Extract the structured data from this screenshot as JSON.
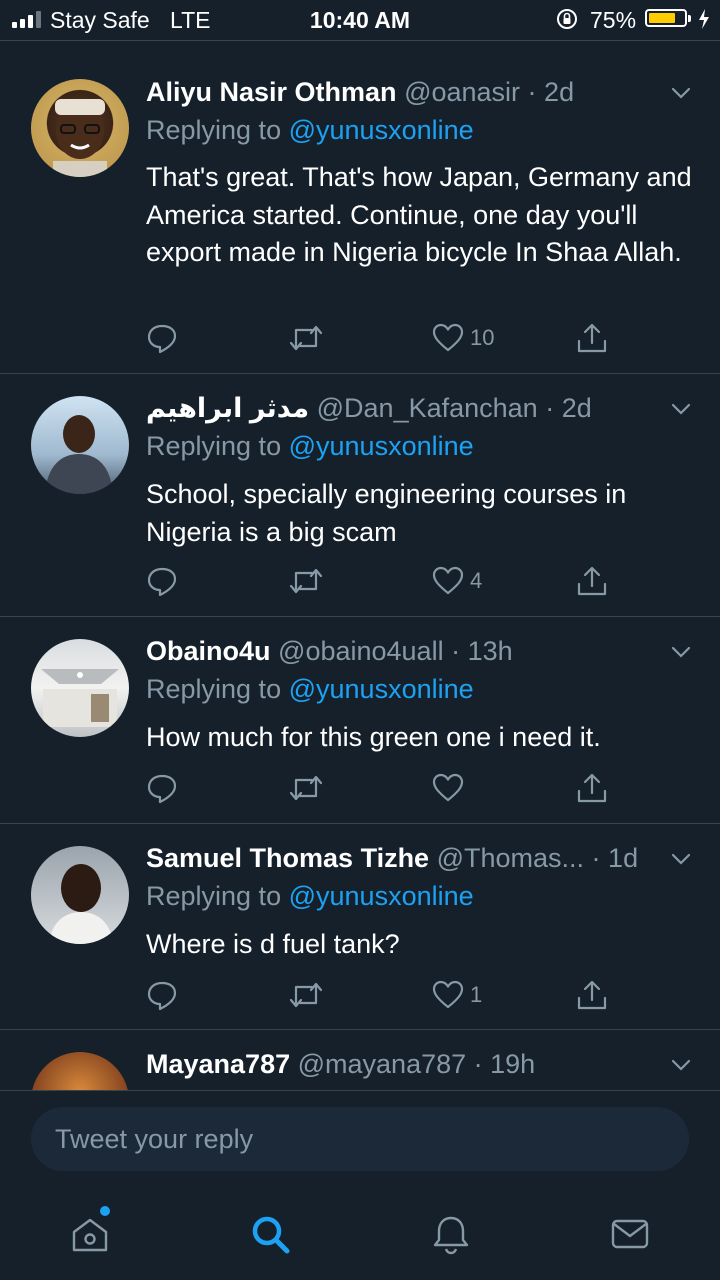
{
  "status_bar": {
    "carrier": "Stay Safe",
    "network": "LTE",
    "time": "10:40 AM",
    "battery_percent": "75%",
    "battery_level": 0.75,
    "battery_color": "#ffcc00"
  },
  "tweets": [
    {
      "name": "Aliyu Nasir Othman",
      "handle": "@oanasir",
      "time": "2d",
      "replying_label": "Replying to",
      "replying_to": "@yunusxonline",
      "text": "That's great. That's how Japan, Germany and America started. Continue, one day you'll export made in Nigeria bicycle In Shaa Allah.",
      "likes": "10"
    },
    {
      "name": "مدثر ابراهيم",
      "handle": "@Dan_Kafanchan",
      "time": "2d",
      "replying_label": "Replying to",
      "replying_to": "@yunusxonline",
      "text": "School, specially engineering courses in Nigeria is a big scam",
      "likes": "4"
    },
    {
      "name": "Obaino4u",
      "handle": "@obaino4uall",
      "time": "13h",
      "replying_label": "Replying to",
      "replying_to": "@yunusxonline",
      "text": "How much for this green one i need it.",
      "likes": ""
    },
    {
      "name": "Samuel Thomas Tizhe",
      "handle": "@Thomas...",
      "time": "1d",
      "replying_label": "Replying to",
      "replying_to": "@yunusxonline",
      "text": "Where is d fuel tank?",
      "likes": "1"
    },
    {
      "name": "Mayana787",
      "handle": "@mayana787",
      "time": "19h"
    }
  ],
  "reply_bar": {
    "placeholder": "Tweet your reply"
  },
  "tab_bar": {
    "items": [
      "home-icon",
      "search-icon",
      "bell-icon",
      "mail-icon"
    ],
    "active": "search-icon",
    "accent_color": "#1da1f2"
  },
  "colors": {
    "background": "#15202b",
    "secondary_text": "#8899a6",
    "link": "#1da1f2",
    "divider": "#38444d"
  }
}
